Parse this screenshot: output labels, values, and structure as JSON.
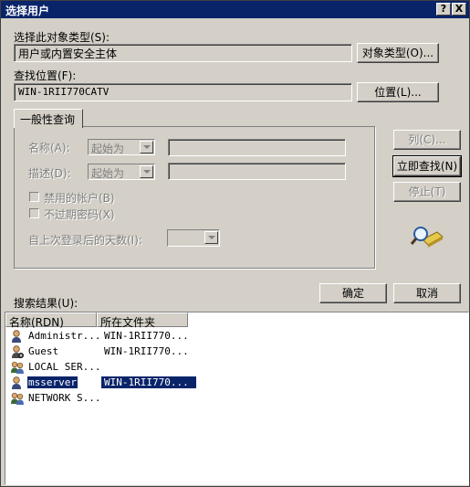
{
  "window": {
    "title": "选择用户",
    "help_label": "?",
    "close_label": "X"
  },
  "object_type": {
    "label": "选择此对象类型(S):",
    "value": "用户或内置安全主体",
    "button": "对象类型(O)..."
  },
  "location": {
    "label": "查找位置(F):",
    "value": "WIN-1RII770CATV",
    "button": "位置(L)..."
  },
  "query": {
    "tab": "一般性查询",
    "name_label": "名称(A):",
    "name_mode": "起始为",
    "desc_label": "描述(D):",
    "desc_mode": "起始为",
    "disabled_accounts": "禁用的帐户(B)",
    "non_expiring_pw": "不过期密码(X)",
    "days_label": "自上次登录后的天数(I):"
  },
  "actions": {
    "columns": "列(C)...",
    "find_now": "立即查找(N)",
    "stop": "停止(T)",
    "ok": "确定",
    "cancel": "取消"
  },
  "results": {
    "label": "搜索结果(U):",
    "columns": [
      "名称(RDN)",
      "所在文件夹"
    ],
    "rows": [
      {
        "name": "Administr...",
        "folder": "WIN-1RII770...",
        "icon": "user-icon"
      },
      {
        "name": "Guest",
        "folder": "WIN-1RII770...",
        "icon": "guest-user-icon"
      },
      {
        "name": "LOCAL SER...",
        "folder": "",
        "icon": "group-icon"
      },
      {
        "name": "msserver",
        "folder": "WIN-1RII770...",
        "icon": "user-icon",
        "selected": true
      },
      {
        "name": "NETWORK S...",
        "folder": "",
        "icon": "group-icon"
      }
    ]
  },
  "colors": {
    "titlebar": "#0a246a",
    "face": "#d4d0c8",
    "selection": "#0a246a"
  }
}
